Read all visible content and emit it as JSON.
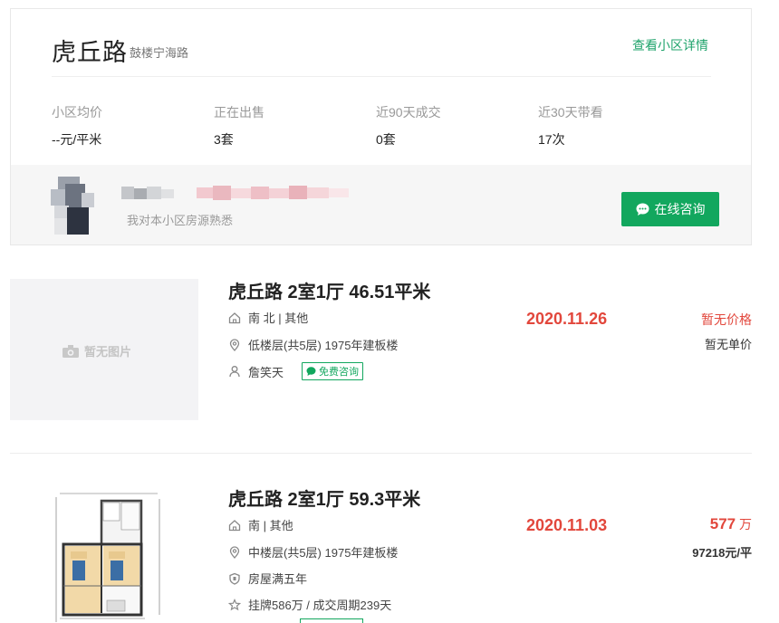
{
  "community": {
    "name": "虎丘路",
    "district": "鼓楼宁海路",
    "detail_link": "查看小区详情",
    "stats": [
      {
        "label": "小区均价",
        "value": "--元/平米"
      },
      {
        "label": "正在出售",
        "value": "3套"
      },
      {
        "label": "近90天成交",
        "value": "0套"
      },
      {
        "label": "近30天带看",
        "value": "17次"
      }
    ],
    "agent": {
      "desc": "我对本小区房源熟悉",
      "consult_label": "在线咨询"
    }
  },
  "listings": [
    {
      "title": "虎丘路 2室1厅 46.51平米",
      "orientation": "南 北 | 其他",
      "floor": "低楼层(共5层) 1975年建板楼",
      "agent_name": "詹笑天",
      "free_consult": "免费咨询",
      "no_image": "暂无图片",
      "date": "2020.11.26",
      "price": "暂无价格",
      "unit_price": "暂无单价"
    },
    {
      "title": "虎丘路 2室1厅 59.3平米",
      "orientation": "南 | 其他",
      "floor": "中楼层(共5层) 1975年建板楼",
      "tag": "房屋满五年",
      "listing_info": "挂牌586万 / 成交周期239天",
      "date": "2020.11.03",
      "price_value": "577",
      "price_unit": "万",
      "unit_price": "97218元/平"
    }
  ],
  "colors": {
    "accent_green": "#12a75e",
    "link_green": "#1fa36b",
    "price_red": "#e2473c"
  }
}
